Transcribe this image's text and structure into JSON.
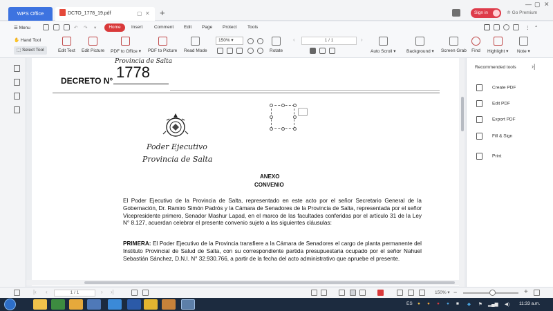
{
  "titlebar": {
    "app_tab": "WPS Office",
    "doc_tab": "DCTO_1778_19.pdf",
    "sign_in": "Sign in",
    "go_premium": "Go Premium"
  },
  "menu": {
    "menu_label": "Menu",
    "tabs": [
      "Home",
      "Insert",
      "Comment",
      "Edit",
      "Page",
      "Protect",
      "Tools"
    ]
  },
  "toolbar": {
    "hand_tool": "Hand Tool",
    "select_tool": "Select Tool",
    "edit_text": "Edit Text",
    "edit_picture": "Edit Picture",
    "pdf_to_office": "PDF to Office",
    "pdf_to_picture": "PDF to Picture",
    "read_mode": "Read Mode",
    "zoom": "150%",
    "rotate": "Rotate",
    "page_indicator": "1 / 1",
    "auto_scroll": "Auto Scroll",
    "background": "Background",
    "screen_grab": "Screen Grab",
    "find": "Find",
    "highlight": "Highlight",
    "note": "Note"
  },
  "document": {
    "provincia_header": "Provincia de Salta",
    "decreto_label": "DECRETO N°",
    "decreto_number": "1778",
    "poder_ejecutivo": "Poder Ejecutivo",
    "provincia_sub": "Provincia de Salta",
    "anexo": "ANEXO",
    "convenio": "CONVENIO",
    "paragraph1": "El Poder Ejecutivo de la Provincia de Salta, representado en este acto por el señor Secretario General de la Gobernación, Dr. Ramiro Simón Padrós y la Cámara de Senadores de la Provincia de Salta, representada por el señor Vicepresidente primero, Senador Mashur Lapad, en el marco de las facultades conferidas por el artículo 31 de la Ley N° 8.127, acuerdan celebrar el presente convenio sujeto a las siguientes cláusulas:",
    "primera_label": "PRIMERA:",
    "paragraph2": "El Poder Ejecutivo de la Provincia transfiere a la Cámara de Senadores el cargo de planta permanente del Instituto Provincial de Salud de Salta, con su correspondiente partida presupuestaria ocupado por el señor Nahuel Sebastián Sánchez, D.N.I. N° 32.930.766, a partir de la fecha del acto administrativo que apruebe el presente."
  },
  "right_panel": {
    "title": "Recommended tools",
    "items": [
      "Create PDF",
      "Edit PDF",
      "Export PDF",
      "Fill & Sign",
      "Print"
    ]
  },
  "statusbar": {
    "page": "1 / 1",
    "zoom": "150%"
  },
  "taskbar": {
    "language": "ES",
    "clock": "11:33 a.m."
  },
  "colors": {
    "accent": "#d9393a",
    "wps_blue": "#3d73e0",
    "taskbar": "#1c2b3f"
  }
}
